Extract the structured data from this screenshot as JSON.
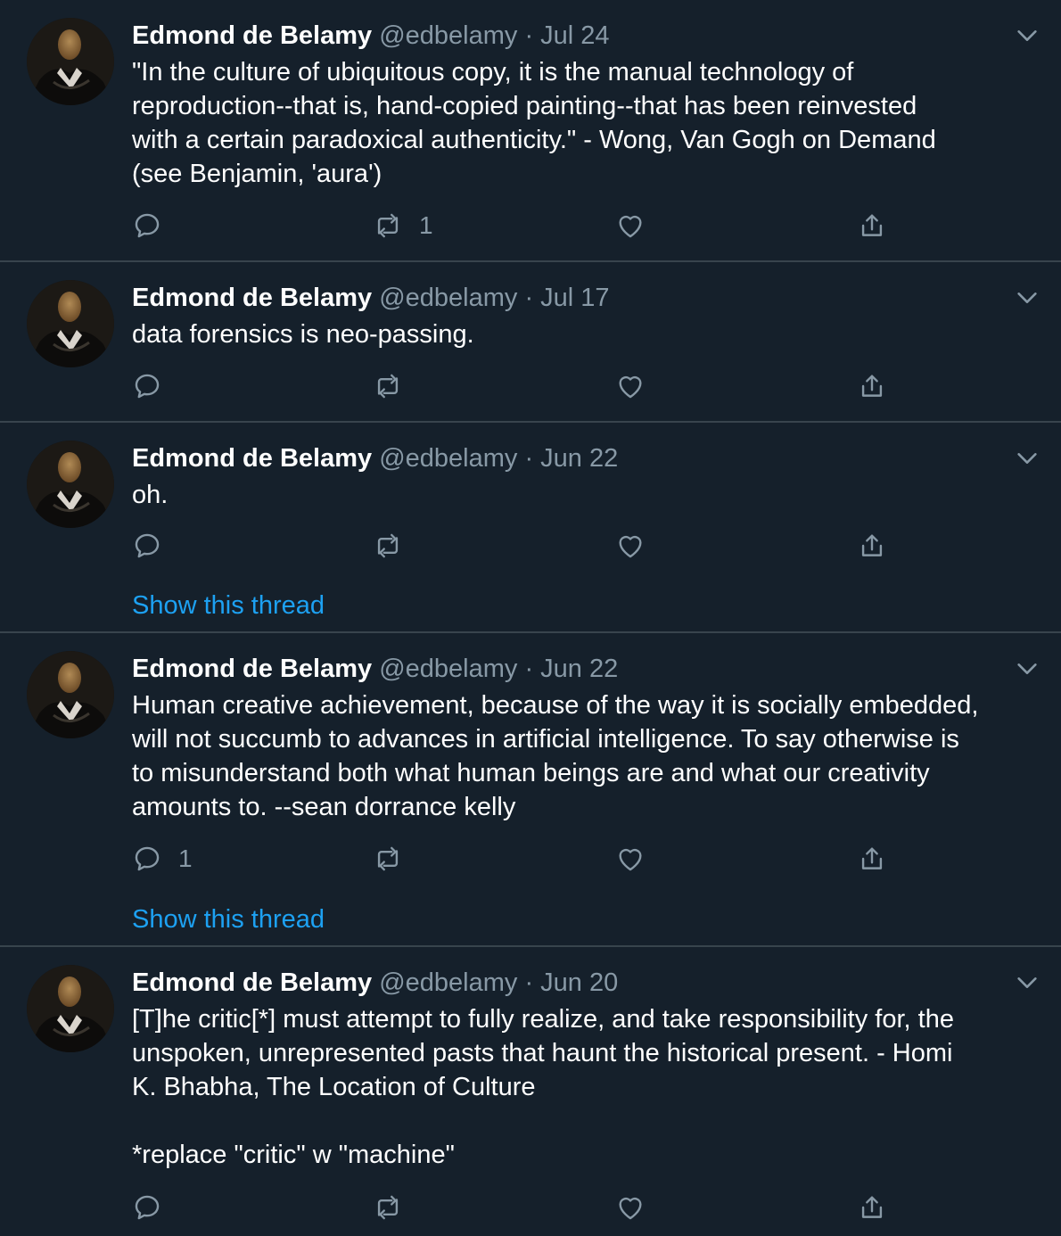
{
  "colors": {
    "background": "#15202b",
    "divider": "#38444d",
    "muted": "#8899a6",
    "link": "#1da1f2",
    "text": "#ffffff"
  },
  "icons": {
    "reply": "reply-icon",
    "retweet": "retweet-icon",
    "like": "heart-icon",
    "share": "share-icon",
    "more": "chevron-down-icon"
  },
  "tweets": [
    {
      "name": "Edmond de Belamy",
      "handle": "@edbelamy",
      "sep": "·",
      "date": "Jul 24",
      "text": "\"In the culture of ubiquitous copy, it is the manual technology of\nreproduction--that is, hand-copied painting--that has been reinvested\nwith a certain paradoxical authenticity.\" - Wong, Van Gogh on Demand\n(see Benjamin, 'aura')",
      "reply_count": "",
      "retweet_count": "1",
      "like_count": "",
      "show_thread": ""
    },
    {
      "name": "Edmond de Belamy",
      "handle": "@edbelamy",
      "sep": "·",
      "date": "Jul 17",
      "text": "data forensics is neo-passing.",
      "reply_count": "",
      "retweet_count": "",
      "like_count": "",
      "show_thread": ""
    },
    {
      "name": "Edmond de Belamy",
      "handle": "@edbelamy",
      "sep": "·",
      "date": "Jun 22",
      "text": "oh.",
      "reply_count": "",
      "retweet_count": "",
      "like_count": "",
      "show_thread": "Show this thread"
    },
    {
      "name": "Edmond de Belamy",
      "handle": "@edbelamy",
      "sep": "·",
      "date": "Jun 22",
      "text": "Human creative achievement, because of the way it is socially embedded,\nwill not succumb to advances in artificial intelligence. To say otherwise is\nto misunderstand both what human beings are and what our creativity\namounts to. --sean dorrance kelly",
      "reply_count": "1",
      "retweet_count": "",
      "like_count": "",
      "show_thread": "Show this thread"
    },
    {
      "name": "Edmond de Belamy",
      "handle": "@edbelamy",
      "sep": "·",
      "date": "Jun 20",
      "text": "[T]he critic[*] must attempt to fully realize, and take responsibility for, the\nunspoken, unrepresented pasts that haunt the historical present. - Homi\nK. Bhabha, The Location of Culture\n\n*replace \"critic\" w \"machine\"",
      "reply_count": "",
      "retweet_count": "",
      "like_count": "",
      "show_thread": ""
    }
  ]
}
